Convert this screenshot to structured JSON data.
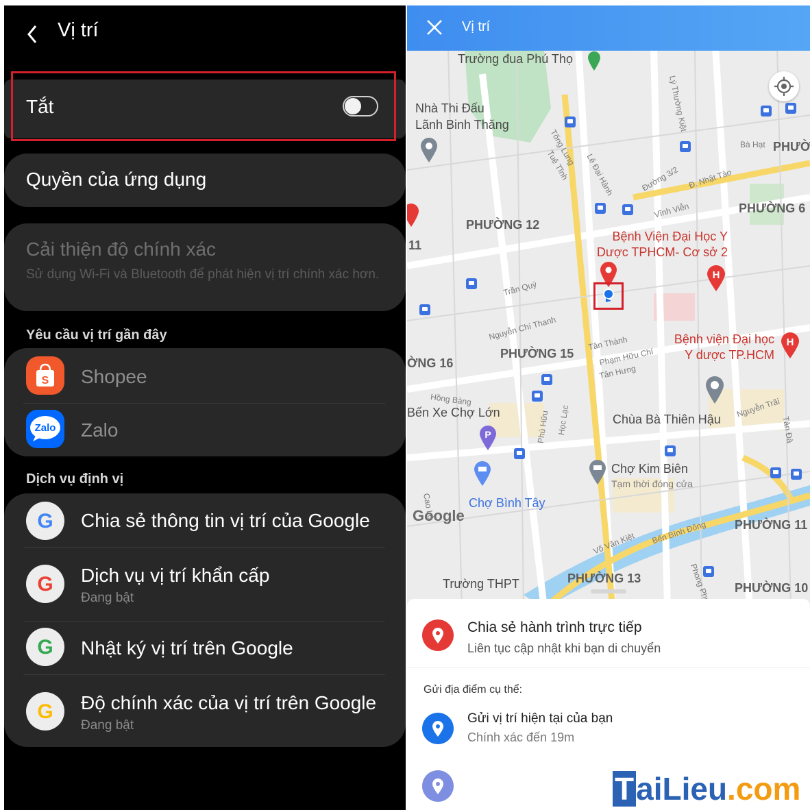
{
  "settings": {
    "header": {
      "title": "Vị trí"
    },
    "location_toggle": {
      "label": "Tắt",
      "on": false
    },
    "app_permissions": {
      "label": "Quyền của ứng dụng"
    },
    "accuracy": {
      "title": "Cải thiện độ chính xác",
      "description": "Sử dụng Wi-Fi và Bluetooth để phát hiện vị trí chính xác hơn."
    },
    "recent_requests": {
      "heading": "Yêu cầu vị trí gần đây",
      "apps": [
        "Shopee",
        "Zalo"
      ]
    },
    "services": {
      "heading": "Dịch vụ định vị",
      "items": [
        {
          "title": "Chia sẻ thông tin vị trí của Google",
          "subtitle": ""
        },
        {
          "title": "Dịch vụ vị trí khẩn cấp",
          "subtitle": "Đang bật"
        },
        {
          "title": "Nhật ký vị trí trên Google",
          "subtitle": ""
        },
        {
          "title": "Độ chính xác của vị trí trên Google",
          "subtitle": "Đang bật"
        }
      ]
    },
    "icon_letters": {
      "google": "G",
      "shopee": "S",
      "zalo": "Zalo"
    }
  },
  "map": {
    "header": {
      "title": "Vị trí"
    },
    "labels": {
      "truong_dua": "Trường đua Phú Thọ",
      "nha_thi_dau_1": "Nhà Thi Đấu",
      "nha_thi_dau_2": "Lãnh Binh Thăng",
      "phuong12": "PHƯỜNG 12",
      "phuong6": "PHƯỜNG 6",
      "phuong_top": "PHƯỜ",
      "phuong15": "PHƯỜNG 15",
      "phuong16": "ỜNG 16",
      "phuong11": "PHƯỜNG 11",
      "phuong13": "PHƯỜNG 13",
      "phuong10": "PHƯỜNG 10",
      "label_11": "11",
      "ben_xe": "Bến Xe Chợ Lớn",
      "chua_ba": "Chùa Bà Thiên Hậu",
      "cho_kim_bien": "Chợ Kim Biên",
      "tam_thoi": "Tạm thời đóng cửa",
      "cho_binh_tay": "Chợ Bình Tây",
      "truong_thpt": "Trường THPT",
      "google": "Google"
    },
    "red_labels": {
      "bv1_l1": "Bệnh Viện Đại Học Y",
      "bv1_l2": "Dược TPHCM- Cơ sở 2",
      "bv2_l1": "Bệnh viện Đại học",
      "bv2_l2": "Y dược TP.HCM"
    },
    "streets": {
      "ly_thuong_kiet": "Lý Thường Kiệt",
      "tong_lung": "Tống Lung",
      "tue_tinh": "Tuệ Tĩnh",
      "le_dai_hanh": "Lê Đại Hành",
      "duong32": "Đường 3/2",
      "ba_hat": "Bà Hạt",
      "nhat_tao": "Đ. Nhật Tảo",
      "vinh_vien": "Vĩnh Viễn",
      "tran_quy": "Trần Quý",
      "nguyen_chi_thanh": "Nguyễn Chí Thanh",
      "tan_thanh": "Tân Thành",
      "pham_huu_chi": "Phạm Hữu Chí",
      "tan_hung": "Tân Hưng",
      "hong_bang": "Hồng Bàng",
      "phu_huu": "Phú Hữu",
      "hoc_lac": "Học Lạc",
      "nguyen_trai": "Nguyễn Trãi",
      "tan_da": "Tản Đà",
      "vo_van_kiet": "Võ Văn Kiệt",
      "ben_binh_dong": "Bến Bình Đông",
      "phong_phu": "Phong Phú",
      "cao_lo": "Cao Lỗ"
    },
    "sheet": {
      "live_title": "Chia sẻ hành trình trực tiếp",
      "live_sub": "Liên tục cập nhật khi bạn di chuyển",
      "section": "Gửi địa điểm cụ thể:",
      "current_title": "Gửi vị trí hiện tại của bạn",
      "current_sub": "Chính xác đến 19m"
    },
    "pin_letters": {
      "hospital": "H",
      "parking": "P"
    }
  },
  "watermark": {
    "part1": "T",
    "part2": "ai",
    "part3": "Lieu",
    "part4": ".com"
  },
  "colors": {
    "toggle_highlight": "#d3202a",
    "map_header": "#3e8df0",
    "pin_red": "#e53935",
    "current_blue": "#1a73e8",
    "watermark_orange": "#f39c12"
  }
}
